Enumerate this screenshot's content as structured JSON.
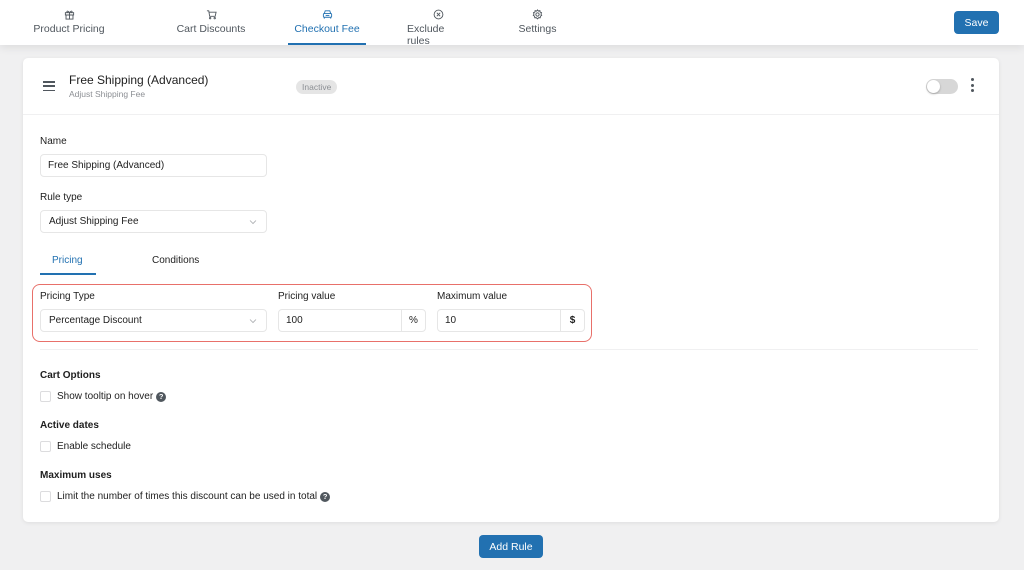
{
  "nav": {
    "tabs": [
      {
        "label": "Product Pricing",
        "icon": "gift-icon"
      },
      {
        "label": "Cart Discounts",
        "icon": "cart-icon"
      },
      {
        "label": "Checkout Fee",
        "icon": "car-icon",
        "active": true
      },
      {
        "label": "Exclude rules",
        "icon": "circle-x-icon"
      },
      {
        "label": "Settings",
        "icon": "gear-icon"
      }
    ],
    "save_label": "Save"
  },
  "rule": {
    "title": "Free Shipping (Advanced)",
    "subtitle": "Adjust Shipping Fee",
    "status": "Inactive",
    "enabled": false
  },
  "form": {
    "name_label": "Name",
    "name_value": "Free Shipping (Advanced)",
    "rule_type_label": "Rule type",
    "rule_type_value": "Adjust Shipping Fee",
    "subtabs": [
      {
        "label": "Pricing",
        "active": true
      },
      {
        "label": "Conditions"
      }
    ],
    "pricing": {
      "type_label": "Pricing Type",
      "type_value": "Percentage Discount",
      "value_label": "Pricing value",
      "value": "100",
      "value_suffix": "%",
      "max_label": "Maximum value",
      "max_value": "10",
      "max_suffix": "$"
    },
    "cart_options": {
      "title": "Cart Options",
      "tooltip_label": "Show tooltip on hover",
      "tooltip_checked": false
    },
    "active_dates": {
      "title": "Active dates",
      "schedule_label": "Enable schedule",
      "schedule_checked": false
    },
    "max_uses": {
      "title": "Maximum uses",
      "limit_label": "Limit the number of times this discount can be used in total",
      "limit_checked": false
    },
    "help_glyph": "?"
  },
  "footer": {
    "add_rule_label": "Add Rule"
  },
  "colors": {
    "accent": "#2271b1",
    "highlight": "#e8706a",
    "badge_bg": "#e5e5e5"
  }
}
